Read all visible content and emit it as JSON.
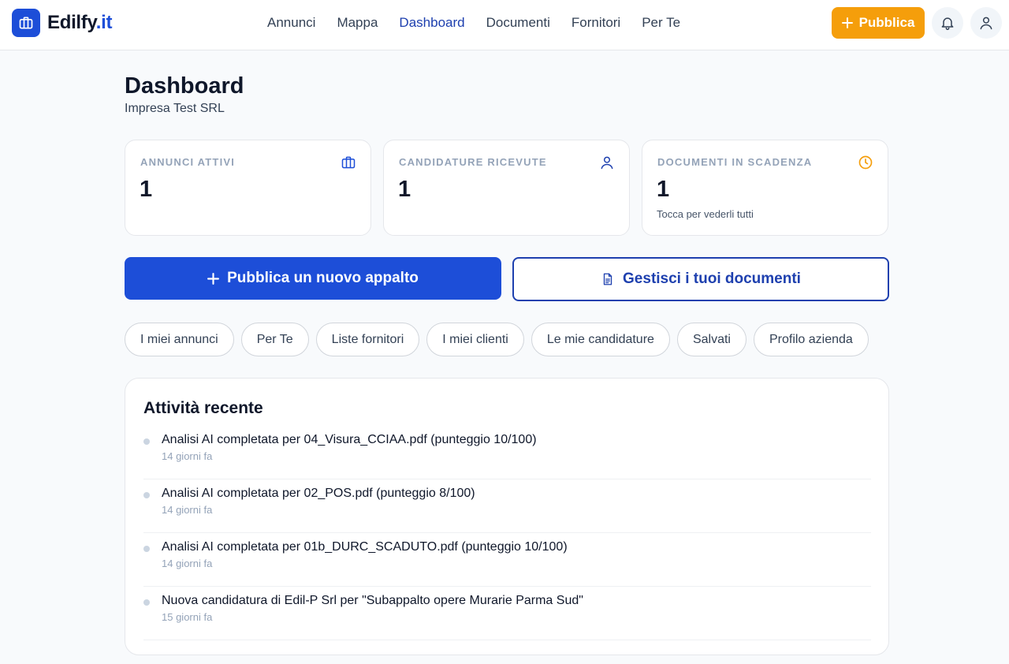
{
  "brand": {
    "name": "Edilfy",
    "tld": ".it",
    "color": "#1d4ed8"
  },
  "nav": [
    {
      "label": "Annunci"
    },
    {
      "label": "Mappa"
    },
    {
      "label": "Dashboard",
      "active": true
    },
    {
      "label": "Documenti"
    },
    {
      "label": "Fornitori"
    },
    {
      "label": "Per Te"
    }
  ],
  "header_actions": {
    "publish_label": "Pubblica",
    "publish_color": "#f59e0b"
  },
  "page": {
    "title": "Dashboard",
    "subtitle": "Impresa Test SRL"
  },
  "stats": [
    {
      "label": "ANNUNCI ATTIVI",
      "value": "1",
      "icon": "briefcase-icon",
      "note": ""
    },
    {
      "label": "CANDIDATURE RICEVUTE",
      "value": "1",
      "icon": "user-icon",
      "note": ""
    },
    {
      "label": "DOCUMENTI IN SCADENZA",
      "value": "1",
      "icon": "clock-icon",
      "note": "Tocca per vederli tutti"
    }
  ],
  "actions": {
    "primary_label": "Pubblica un nuovo appalto",
    "secondary_label": "Gestisci i tuoi documenti"
  },
  "chips": [
    "I miei annunci",
    "Per Te",
    "Liste fornitori",
    "I miei clienti",
    "Le mie candidature",
    "Salvati",
    "Profilo azienda"
  ],
  "activity": {
    "title": "Attività recente",
    "items": [
      {
        "text": "Analisi AI completata per 04_Visura_CCIAA.pdf (punteggio 10/100)",
        "time": "14 giorni fa"
      },
      {
        "text": "Analisi AI completata per 02_POS.pdf (punteggio 8/100)",
        "time": "14 giorni fa"
      },
      {
        "text": "Analisi AI completata per 01b_DURC_SCADUTO.pdf (punteggio 10/100)",
        "time": "14 giorni fa"
      },
      {
        "text": "Nuova candidatura di Edil-P Srl per \"Subappalto opere Murarie Parma Sud\"",
        "time": "15 giorni fa"
      }
    ]
  }
}
